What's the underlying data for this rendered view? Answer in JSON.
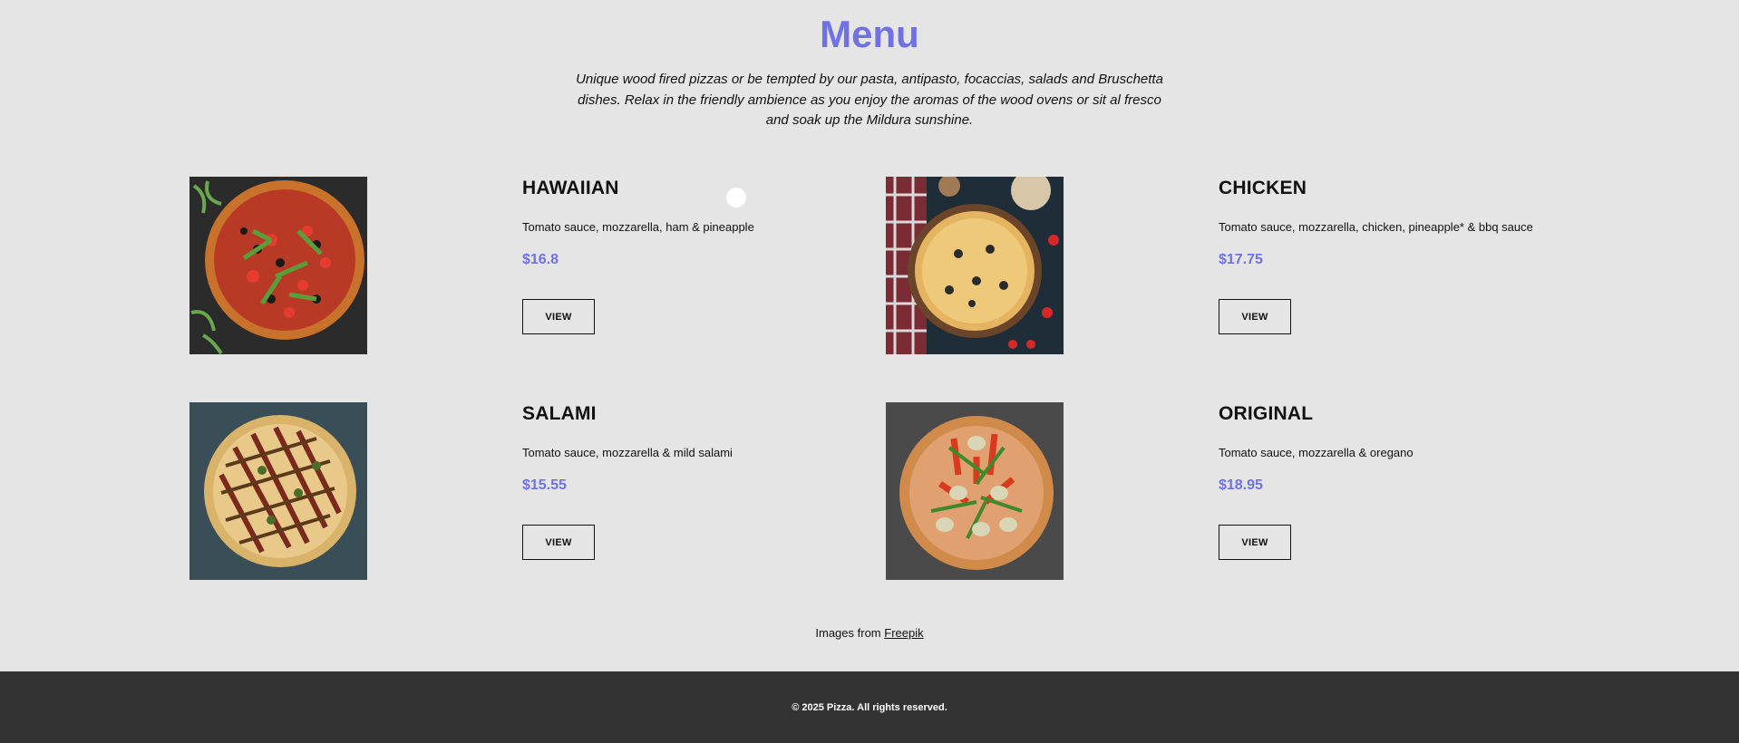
{
  "page": {
    "title": "Menu",
    "intro": "Unique wood fired pizzas or be tempted by our pasta, antipasto, focaccias, salads and Bruschetta dishes. Relax in the friendly ambience as you enjoy the aromas of the wood ovens or sit al fresco and soak up the Mildura sunshine."
  },
  "menu": {
    "items": [
      {
        "name": "HAWAIIAN",
        "description": "Tomato sauce, mozzarella, ham & pineapple",
        "price": "$16.8",
        "button": "VIEW"
      },
      {
        "name": "CHICKEN",
        "description": "Tomato sauce, mozzarella, chicken, pineapple* & bbq sauce",
        "price": "$17.75",
        "button": "VIEW"
      },
      {
        "name": "SALAMI",
        "description": "Tomato sauce, mozzarella & mild salami",
        "price": "$15.55",
        "button": "VIEW"
      },
      {
        "name": "ORIGINAL",
        "description": "Tomato sauce, mozzarella & oregano",
        "price": "$18.95",
        "button": "VIEW"
      }
    ]
  },
  "credit": {
    "prefix": "Images from ",
    "link": "Freepik"
  },
  "footer": {
    "text": "© 2025 Pizza. All rights reserved."
  },
  "colors": {
    "accent": "#7171e6",
    "background": "#e5e5e5",
    "footer_bg": "#333333"
  }
}
